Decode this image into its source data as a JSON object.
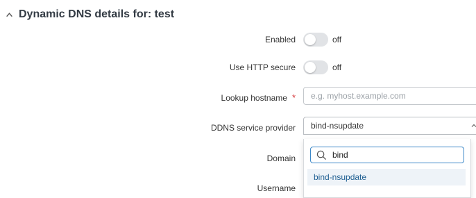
{
  "header": {
    "title": "Dynamic DNS details for: test"
  },
  "form": {
    "enabled": {
      "label": "Enabled",
      "state": "off"
    },
    "https": {
      "label": "Use HTTP secure",
      "state": "off"
    },
    "lookup_hostname": {
      "label": "Lookup hostname",
      "required_mark": "*",
      "value": "",
      "placeholder": "e.g. myhost.example.com"
    },
    "ddns_provider": {
      "label": "DDNS service provider",
      "value": "bind-nsupdate"
    },
    "domain": {
      "label": "Domain"
    },
    "username": {
      "label": "Username"
    }
  },
  "dropdown": {
    "search_value": "bind",
    "options": [
      "bind-nsupdate"
    ]
  },
  "colors": {
    "accent": "#3c88c8",
    "option_highlight": "#eef3f8",
    "option_text": "#1f5f92",
    "required": "#d6383a",
    "toggle_off": "#e1e3e6"
  },
  "icons": {
    "collapse": "chevron-up-icon",
    "select": "chevron-up-icon",
    "search": "search-icon"
  }
}
